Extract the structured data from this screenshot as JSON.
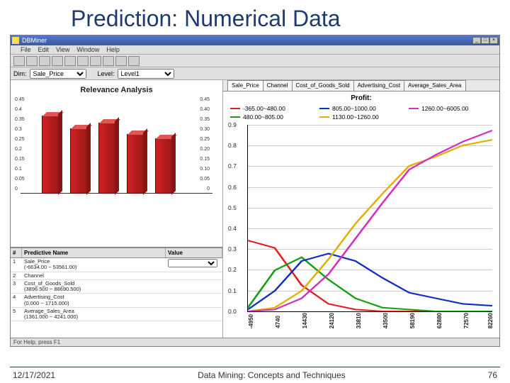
{
  "slide": {
    "title": "Prediction: Numerical Data",
    "footer_date": "12/17/2021",
    "footer_center": "Data Mining: Concepts and Techniques",
    "footer_page": "76"
  },
  "window": {
    "titlebar": "DBMiner",
    "menu": [
      "File",
      "Edit",
      "View",
      "Window",
      "Help"
    ],
    "dim_label": "Dim:",
    "dim_value": "Sale_Price",
    "level_label": "Level:",
    "level_value": "Level1",
    "status": "For Help, press F1"
  },
  "relevance": {
    "title": "Relevance Analysis",
    "y_left": [
      "0.45",
      "0.4",
      "0.35",
      "0.3",
      "0.25",
      "0.2",
      "0.15",
      "0.1",
      "0.05",
      "0"
    ],
    "y_right": [
      "0.45",
      "0.40",
      "0.35",
      "0.30",
      "0.25",
      "0.20",
      "0.15",
      "0.10",
      "0.05",
      "0"
    ]
  },
  "predictive_table": {
    "headers": {
      "idx": "#",
      "name": "Predictive Name",
      "value": "Value"
    },
    "rows": [
      {
        "idx": "1",
        "name": "Sale_Price\n(-6634.00 ~ 53561.00)",
        "value_select": ""
      },
      {
        "idx": "2",
        "name": "Channel",
        "value": ""
      },
      {
        "idx": "3",
        "name": "Cost_of_Goods_Sold\n(3896.500 ~ 88690.500)",
        "value": ""
      },
      {
        "idx": "4",
        "name": "Advertising_Cost\n(0.000 ~ 1715.000)",
        "value": ""
      },
      {
        "idx": "5",
        "name": "Average_Sales_Area\n(1361.000 ~ 4241.000)",
        "value": ""
      }
    ]
  },
  "tabs": [
    "Sale_Price",
    "Channel",
    "Cost_of_Goods_Sold",
    "Advertising_Cost",
    "Average_Sales_Area"
  ],
  "profit": {
    "title": "Profit:",
    "legend": [
      {
        "label": "-365.00~480.00",
        "color": "#e02020"
      },
      {
        "label": "805.00~1000.00",
        "color": "#1030c0"
      },
      {
        "label": "1260.00~6005.00",
        "color": "#d030c0"
      },
      {
        "label": "480.00~805.00",
        "color": "#10a010"
      },
      {
        "label": "1130.00~1260.00",
        "color": "#e0b000"
      }
    ],
    "y_ticks": [
      "0.9",
      "0.8",
      "0.7",
      "0.6",
      "0.5",
      "0.4",
      "0.3",
      "0.2",
      "0.1",
      "0.0"
    ],
    "x_ticks": [
      "-4950",
      "4740",
      "14430",
      "24120",
      "33810",
      "43500",
      "58190",
      "62880",
      "72570",
      "82260"
    ]
  },
  "chart_data": [
    {
      "type": "bar",
      "title": "Relevance Analysis",
      "categories": [
        "1",
        "2",
        "3",
        "4",
        "5"
      ],
      "values": [
        0.42,
        0.35,
        0.38,
        0.32,
        0.3
      ],
      "ylim": [
        0,
        0.45
      ],
      "xlabel": "",
      "ylabel": ""
    },
    {
      "type": "line",
      "title": "Profit:",
      "xlabel": "Sale_Price",
      "ylabel": "",
      "ylim": [
        0.0,
        0.9
      ],
      "x": [
        -4950,
        4740,
        14430,
        24120,
        33810,
        43500,
        58190,
        62880,
        72570,
        82260
      ],
      "series": [
        {
          "name": "-365.00~480.00",
          "color": "#e02020",
          "values": [
            0.34,
            0.3,
            0.12,
            0.03,
            0.01,
            0.0,
            0.0,
            0.0,
            0.0,
            0.0
          ]
        },
        {
          "name": "480.00~805.00",
          "color": "#10a010",
          "values": [
            0.02,
            0.2,
            0.26,
            0.15,
            0.06,
            0.02,
            0.01,
            0.0,
            0.0,
            0.0
          ]
        },
        {
          "name": "805.00~1000.00",
          "color": "#1030c0",
          "values": [
            0.01,
            0.1,
            0.24,
            0.28,
            0.24,
            0.16,
            0.09,
            0.06,
            0.04,
            0.03
          ]
        },
        {
          "name": "1130.00~1260.00",
          "color": "#e0b000",
          "values": [
            0.0,
            0.02,
            0.1,
            0.25,
            0.42,
            0.57,
            0.7,
            0.75,
            0.8,
            0.83
          ]
        },
        {
          "name": "1260.00~6005.00",
          "color": "#d030c0",
          "values": [
            0.0,
            0.01,
            0.06,
            0.18,
            0.35,
            0.52,
            0.68,
            0.76,
            0.82,
            0.87
          ]
        }
      ]
    }
  ]
}
